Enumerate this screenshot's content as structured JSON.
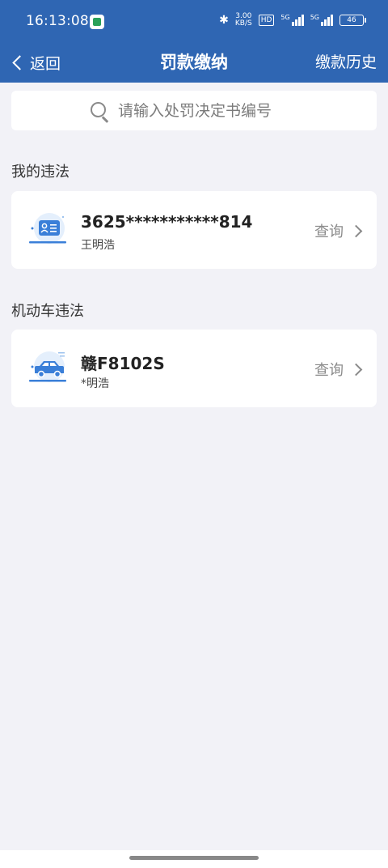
{
  "status_bar": {
    "time": "16:13:08",
    "net_speed_value": "3.00",
    "net_speed_unit": "KB/S",
    "hd_label": "HD",
    "signal1_label": "5G",
    "signal2_label": "5G",
    "battery": "46"
  },
  "nav": {
    "back_label": "返回",
    "title": "罚款缴纳",
    "history_label": "缴款历史"
  },
  "search": {
    "placeholder": "请输入处罚决定书编号",
    "value": ""
  },
  "sections": {
    "my_violations": {
      "title": "我的违法",
      "card": {
        "main": "3625***********814",
        "sub": "王明浩",
        "action": "查询",
        "icon": "id-card-icon"
      }
    },
    "vehicle_violations": {
      "title": "机动车违法",
      "card": {
        "main": "赣F8102S",
        "sub": "*明浩",
        "action": "查询",
        "icon": "car-icon"
      }
    }
  },
  "colors": {
    "primary": "#2f66b3",
    "background": "#f2f2f7",
    "card": "#ffffff",
    "icon_accent": "#3a7fd8"
  }
}
